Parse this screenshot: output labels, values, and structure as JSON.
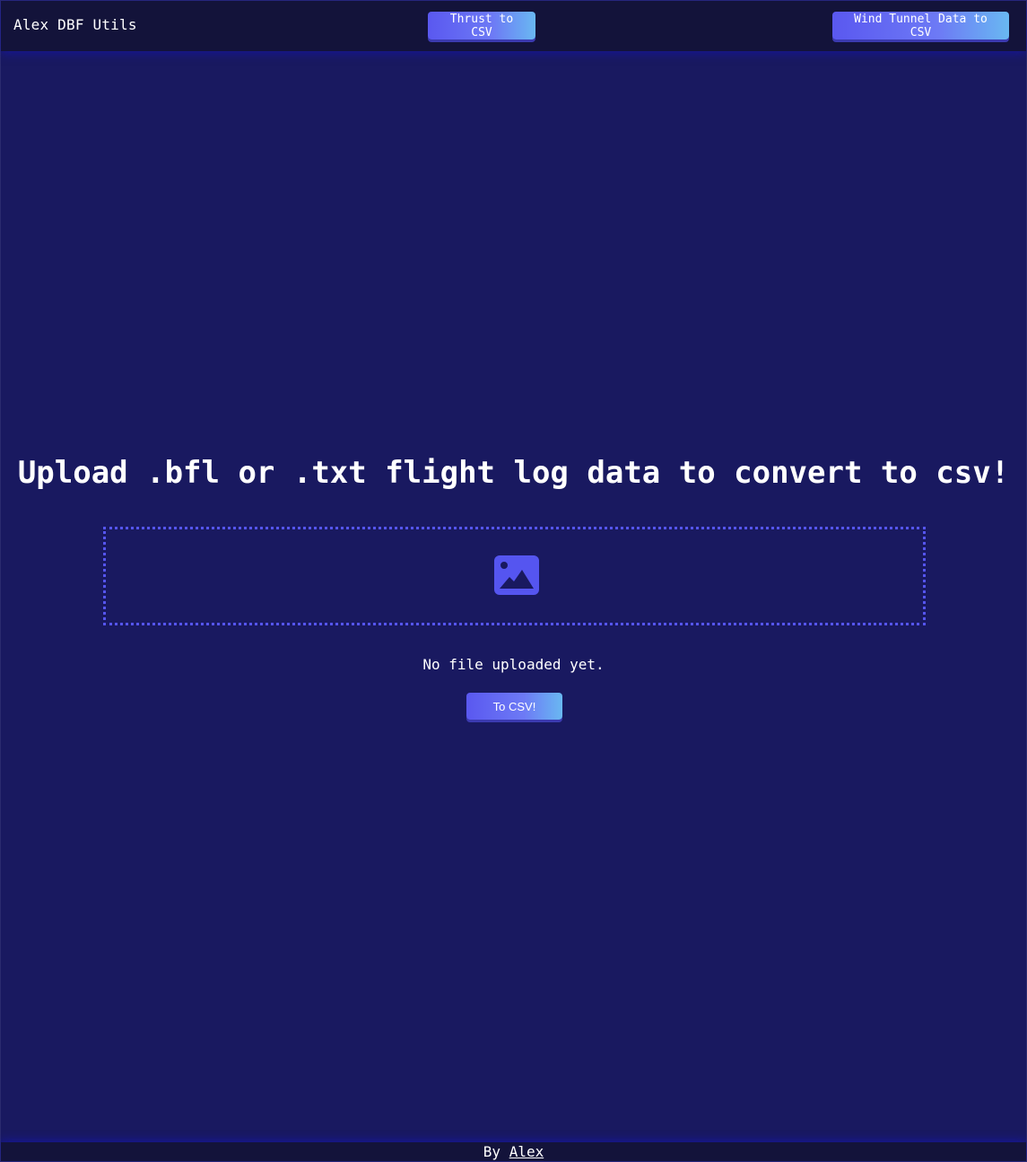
{
  "header": {
    "brand": "Alex DBF Utils",
    "nav": {
      "thrust_label": "Thrust to CSV",
      "wind_label": "Wind Tunnel Data to CSV"
    }
  },
  "main": {
    "heading": "Upload .bfl or .txt flight log data to convert to csv!",
    "dropzone": {
      "icon": "image-icon"
    },
    "status": "No file uploaded yet.",
    "convert_label": "To CSV!"
  },
  "footer": {
    "by_text": "By",
    "author_link": "Alex"
  },
  "colors": {
    "background": "#191960",
    "bar": "#13133a",
    "accent": "#5555f0",
    "button_gradient_start": "#5a58f0",
    "button_gradient_end": "#69b8f2"
  }
}
